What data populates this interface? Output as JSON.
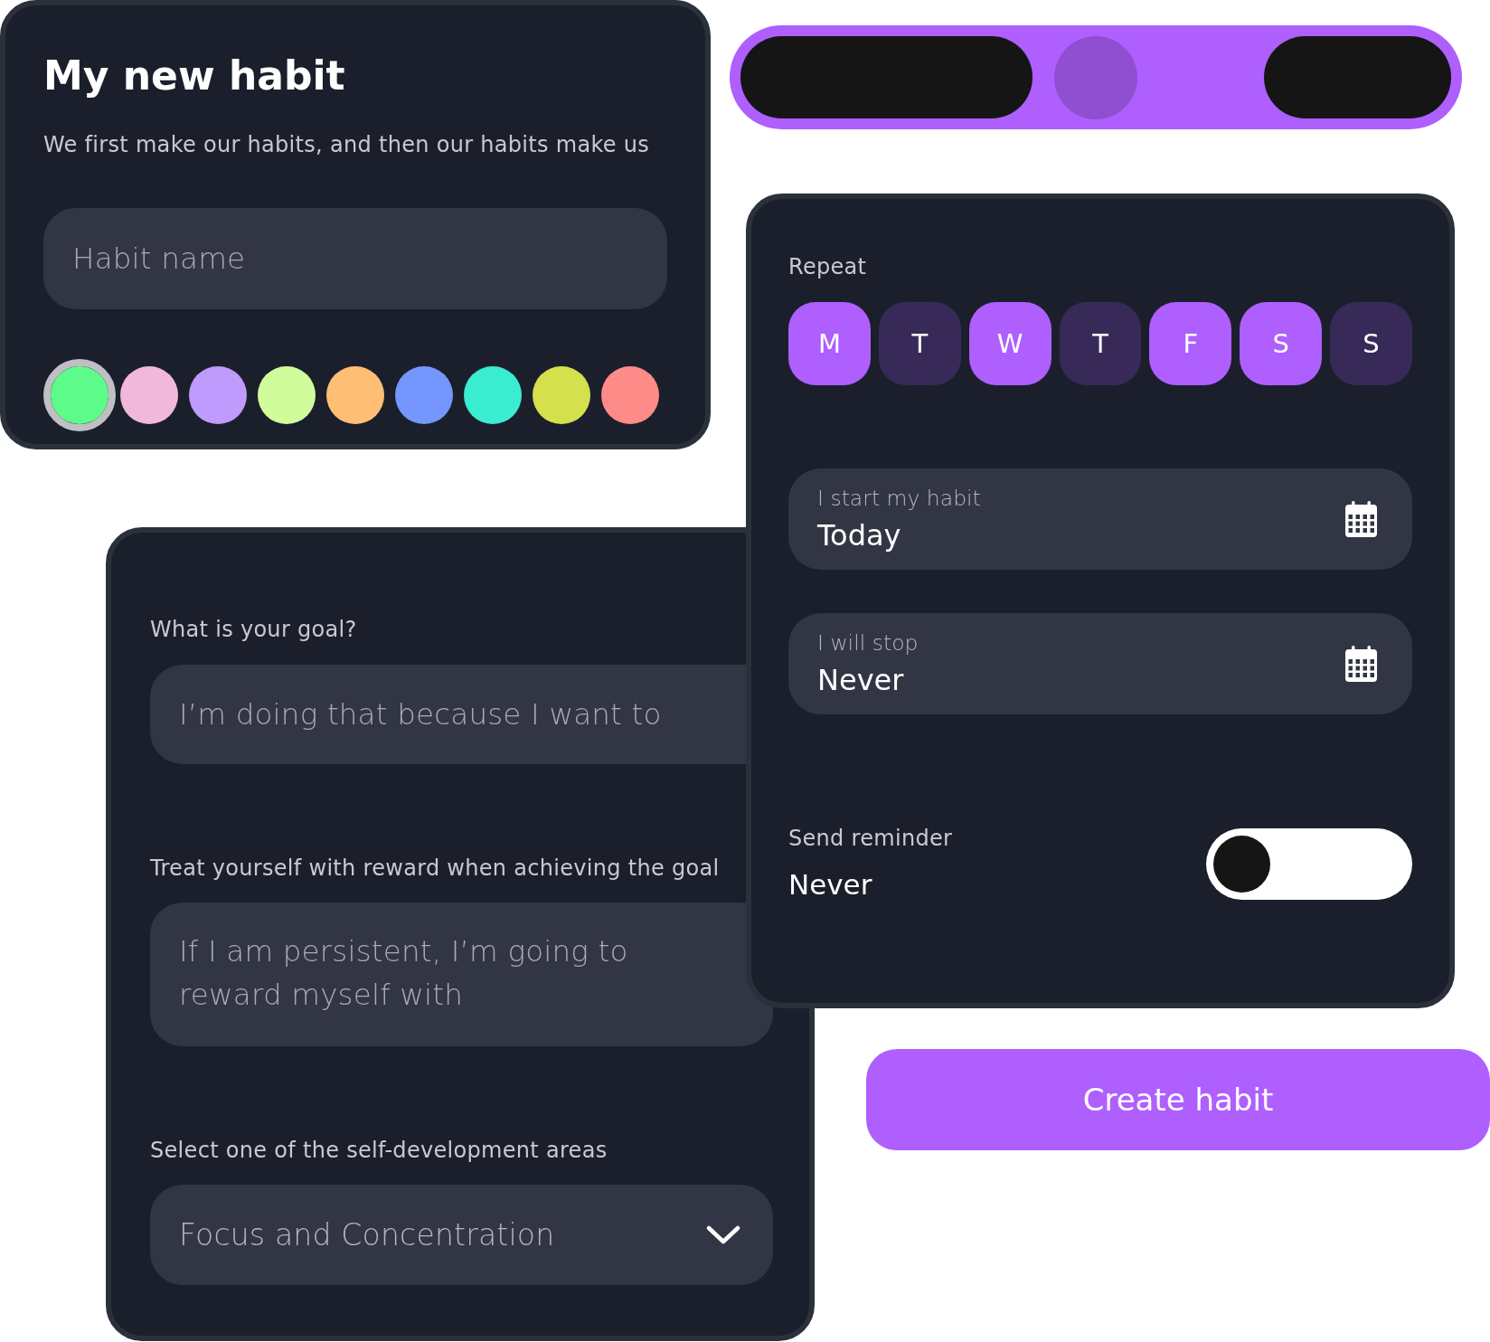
{
  "habit_card": {
    "title": "My new habit",
    "subtitle": "We first make our habits, and then our habits make us",
    "name_field": {
      "placeholder": "Habit name"
    },
    "colors": [
      {
        "color": "#5dfc8a",
        "selected": true
      },
      {
        "color": "#f2b8dc",
        "selected": false
      },
      {
        "color": "#be9bfc",
        "selected": false
      },
      {
        "color": "#d1fc9c",
        "selected": false
      },
      {
        "color": "#febf75",
        "selected": false
      },
      {
        "color": "#7496fd",
        "selected": false
      },
      {
        "color": "#3aecd0",
        "selected": false
      },
      {
        "color": "#d4e04c",
        "selected": false
      },
      {
        "color": "#fd8b88",
        "selected": false
      }
    ]
  },
  "schedule_card": {
    "repeat_label": "Repeat",
    "days": [
      {
        "label": "M",
        "selected": true
      },
      {
        "label": "T",
        "selected": false
      },
      {
        "label": "W",
        "selected": true
      },
      {
        "label": "T",
        "selected": false
      },
      {
        "label": "F",
        "selected": true
      },
      {
        "label": "S",
        "selected": true
      },
      {
        "label": "S",
        "selected": false
      }
    ],
    "start": {
      "label": "I start my habit",
      "value": "Today"
    },
    "stop": {
      "label": "I will stop",
      "value": "Never"
    },
    "reminder": {
      "label": "Send reminder",
      "value": "Never",
      "on": false
    }
  },
  "goal_card": {
    "goal": {
      "label": "What is your goal?",
      "placeholder": "I’m doing that because I want to"
    },
    "reward": {
      "label": "Treat yourself with reward when achieving the goal",
      "placeholder": "If I am persistent, I’m going to reward myself with"
    },
    "area": {
      "label": "Select one of the self-development areas",
      "value": "Focus and Concentration"
    }
  },
  "create_button": "Create habit"
}
